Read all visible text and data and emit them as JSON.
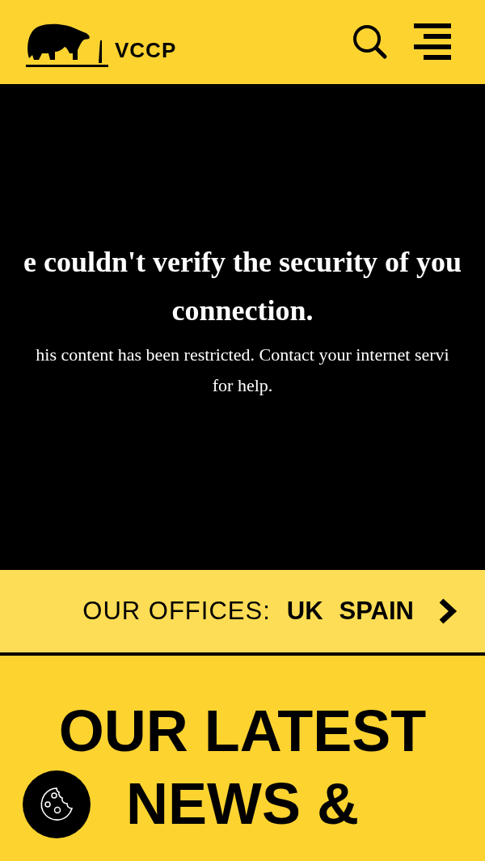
{
  "header": {
    "logo_text": "VCCP"
  },
  "notice": {
    "title_lines": [
      "e couldn't verify the security of you",
      "connection."
    ],
    "message_lines": [
      "his content has been restricted. Contact your internet servi",
      "for help."
    ]
  },
  "offices": {
    "label": "OUR OFFICES:",
    "links": [
      "UK",
      "SPAIN"
    ]
  },
  "latest": {
    "heading_lines": [
      "OUR LATEST",
      "NEWS &"
    ]
  }
}
